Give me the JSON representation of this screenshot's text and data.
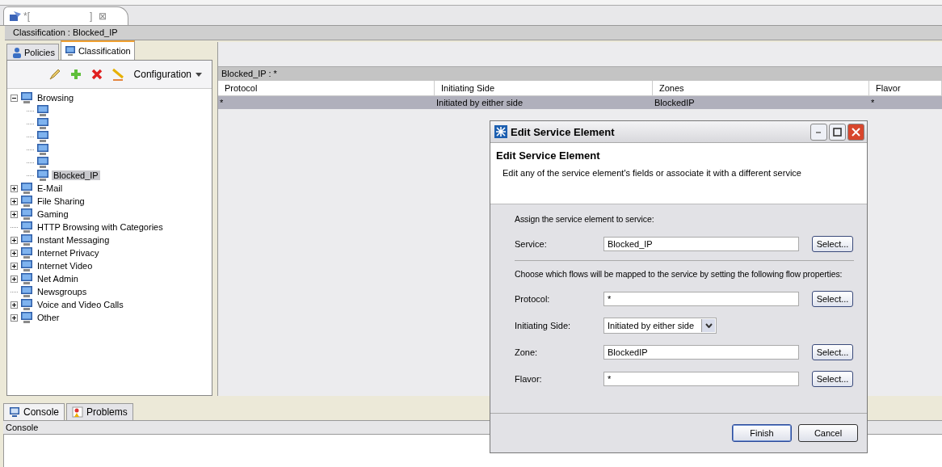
{
  "editor_tab": {
    "title_start": "*[",
    "title_end": "]",
    "close": "⊠"
  },
  "breadcrumb": "Classification : Blocked_IP",
  "left_tabs": [
    {
      "label": "Policies",
      "selected": false
    },
    {
      "label": "Classification",
      "selected": true
    }
  ],
  "toolbar": {
    "menu": "Configuration"
  },
  "tree": [
    {
      "label": "Browsing",
      "expanded": true,
      "selected": false,
      "children": [
        {
          "selected": false
        },
        {
          "selected": false
        },
        {
          "selected": false
        },
        {
          "selected": false
        },
        {
          "selected": false
        },
        {
          "label": "Blocked_IP",
          "selected": true
        }
      ]
    },
    {
      "label": "E-Mail",
      "expanded": false,
      "selected": false
    },
    {
      "label": "File Sharing",
      "expanded": false,
      "selected": false
    },
    {
      "label": "Gaming",
      "expanded": false,
      "selected": false
    },
    {
      "label": "HTTP Browsing with Categories",
      "selected": false
    },
    {
      "label": "Instant Messaging",
      "expanded": false,
      "selected": false
    },
    {
      "label": "Internet Privacy",
      "expanded": false,
      "selected": false
    },
    {
      "label": "Internet Video",
      "expanded": false,
      "selected": false
    },
    {
      "label": "Net Admin",
      "expanded": false,
      "selected": false
    },
    {
      "label": "Newsgroups",
      "selected": false
    },
    {
      "label": "Voice and Video Calls",
      "expanded": false,
      "selected": false
    },
    {
      "label": "Other",
      "expanded": false,
      "selected": false
    }
  ],
  "table": {
    "title": "Blocked_IP : *",
    "columns": [
      "Protocol",
      "Initiating Side",
      "Zones",
      "Flavor"
    ],
    "rows": [
      {
        "cells": [
          "*",
          "Initiated by either side",
          "BlockedIP",
          "*"
        ],
        "selected": true
      }
    ]
  },
  "console": {
    "tabs": [
      {
        "label": "Console",
        "selected": true
      },
      {
        "label": "Problems",
        "selected": false
      }
    ],
    "title": "Console"
  },
  "dialog": {
    "title": "Edit Service Element",
    "heading": "Edit Service Element",
    "description": "Edit any of the service element's fields or associate it with a different service",
    "section1": "Assign the service element to service:",
    "service": {
      "label": "Service:",
      "value": "Blocked_IP",
      "button": "Select..."
    },
    "section2": "Choose which flows will be mapped to the service by setting the following flow properties:",
    "fields": [
      {
        "kind": "text",
        "label": "Protocol:",
        "value": "*",
        "button": "Select..."
      },
      {
        "kind": "dropdown",
        "label": "Initiating Side:",
        "value": "Initiated by either side"
      },
      {
        "kind": "text",
        "label": "Zone:",
        "value": "BlockedIP",
        "button": "Select..."
      },
      {
        "kind": "text",
        "label": "Flavor:",
        "value": "*",
        "button": "Select..."
      }
    ],
    "buttons": [
      "Finish",
      "Cancel"
    ]
  }
}
